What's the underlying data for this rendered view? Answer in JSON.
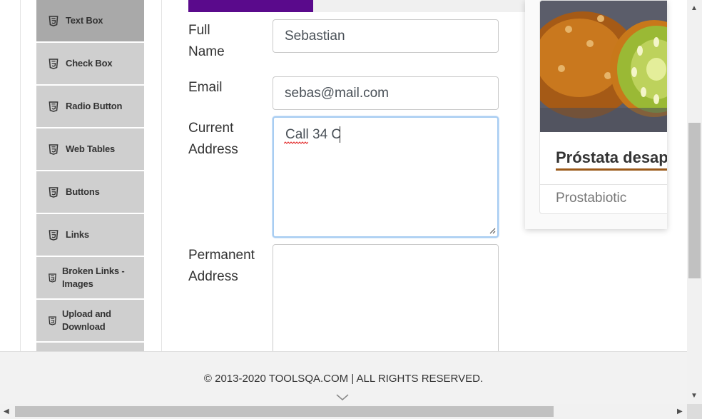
{
  "sidebar": {
    "items": [
      {
        "label": "Text Box",
        "icon": "html5-icon",
        "active": true
      },
      {
        "label": "Check Box",
        "icon": "html5-icon"
      },
      {
        "label": "Radio Button",
        "icon": "html5-icon"
      },
      {
        "label": "Web Tables",
        "icon": "html5-icon"
      },
      {
        "label": "Buttons",
        "icon": "html5-icon"
      },
      {
        "label": "Links",
        "icon": "html5-icon"
      },
      {
        "label": "Broken Links -\nImages",
        "icon": "html5-icon"
      },
      {
        "label": "Upload and\nDownload",
        "icon": "html5-icon"
      }
    ]
  },
  "progress": {
    "value_percent": 35,
    "color": "#5a0a8c"
  },
  "form": {
    "full_name": {
      "label": "Full\nName",
      "value": "Sebastian"
    },
    "email": {
      "label": "Email",
      "value": "sebas@mail.com"
    },
    "current_address": {
      "label": "Current\nAddress",
      "value": "Call 34 C"
    },
    "permanent_address": {
      "label": "Permanent\nAddress",
      "value": ""
    }
  },
  "ad": {
    "title": "Próstata desapar",
    "source": "Prostabiotic",
    "accent_color": "#9b5a1a"
  },
  "footer": {
    "copyright": "© 2013-2020 TOOLSQA.COM | ALL RIGHTS RESERVED."
  },
  "colors": {
    "sidebar_item_bg": "#cfcfcf",
    "sidebar_active_bg": "#a9a9a9",
    "focus_border": "#a8cdf2"
  }
}
